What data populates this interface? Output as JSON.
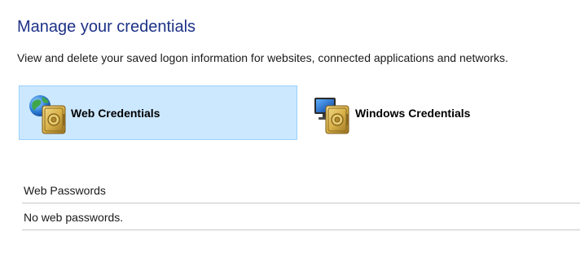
{
  "header": {
    "title": "Manage your credentials",
    "subtitle": "View and delete your saved logon information for websites, connected applications and networks."
  },
  "tabs": [
    {
      "label": "Web Credentials",
      "icon": "web-credentials-vault-icon",
      "selected": true
    },
    {
      "label": "Windows Credentials",
      "icon": "windows-credentials-vault-icon",
      "selected": false
    }
  ],
  "web_passwords": {
    "header": "Web Passwords",
    "empty_text": "No web passwords."
  },
  "colors": {
    "title": "#1e3287",
    "selected_tab_bg": "#cce8ff",
    "selected_tab_border": "#99d1ff",
    "divider": "#c8c8c8"
  }
}
